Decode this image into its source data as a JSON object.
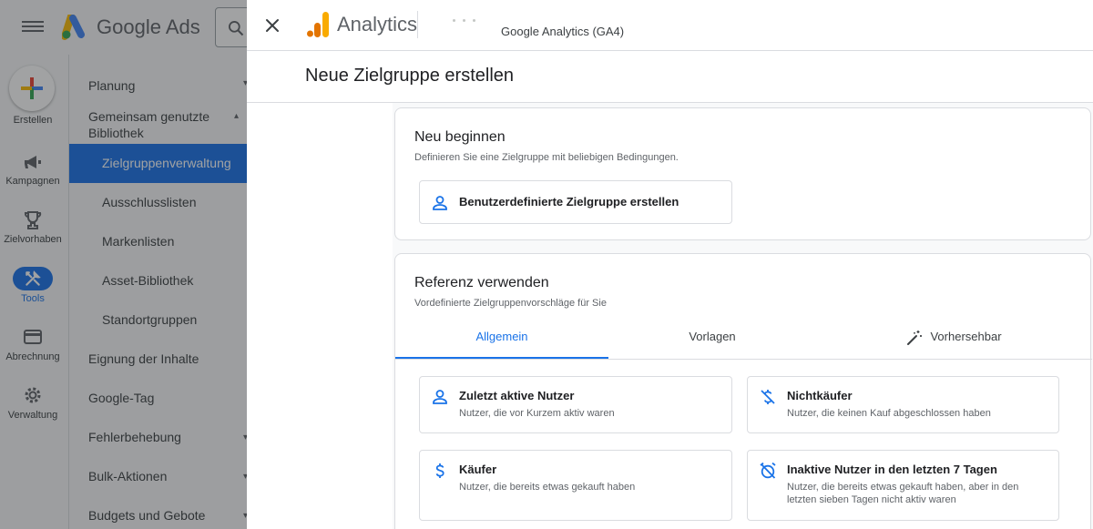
{
  "ads": {
    "title": "Google Ads",
    "rail": {
      "create": "Erstellen",
      "campaigns": "Kampagnen",
      "goals": "Zielvorhaben",
      "tools": "Tools",
      "billing": "Abrechnung",
      "admin": "Verwaltung"
    },
    "nav": {
      "planning": "Planung",
      "shared_library": "Gemeinsam genutzte Bibliothek",
      "audience_manager": "Zielgruppenverwaltung",
      "exclusion_lists": "Ausschlusslisten",
      "brand_lists": "Markenlisten",
      "asset_library": "Asset-Bibliothek",
      "location_groups": "Standortgruppen",
      "content_suitability": "Eignung der Inhalte",
      "google_tag": "Google-Tag",
      "troubleshooting": "Fehlerbehebung",
      "bulk_actions": "Bulk-Aktionen",
      "budgets_bids": "Budgets und Gebote"
    }
  },
  "ga": {
    "app_name": "Analytics",
    "property": "Google Analytics (GA4)",
    "page_title": "Neue Zielgruppe erstellen"
  },
  "start_new": {
    "title": "Neu beginnen",
    "desc": "Definieren Sie eine Zielgruppe mit beliebigen Bedingungen.",
    "custom_button": "Benutzerdefinierte Zielgruppe erstellen"
  },
  "reference": {
    "title": "Referenz verwenden",
    "desc": "Vordefinierte Zielgruppenvorschläge für Sie",
    "tabs": [
      "Allgemein",
      "Vorlagen",
      "Vorhersehbar"
    ],
    "options": [
      {
        "title": "Zuletzt aktive Nutzer",
        "desc": "Nutzer, die vor Kurzem aktiv waren"
      },
      {
        "title": "Nichtkäufer",
        "desc": "Nutzer, die keinen Kauf abgeschlossen haben"
      },
      {
        "title": "Käufer",
        "desc": "Nutzer, die bereits etwas gekauft haben"
      },
      {
        "title": "Inaktive Nutzer in den letzten 7 Tagen",
        "desc": "Nutzer, die bereits etwas gekauft haben, aber in den letzten sieben Tagen nicht aktiv waren"
      }
    ]
  },
  "colors": {
    "accent": "#1a73e8",
    "ads_blue": "#4285f4",
    "ads_yellow": "#fbbc04",
    "ads_green": "#34a853",
    "ga_orange": "#f9ab00",
    "ga_dark_orange": "#e37400"
  }
}
